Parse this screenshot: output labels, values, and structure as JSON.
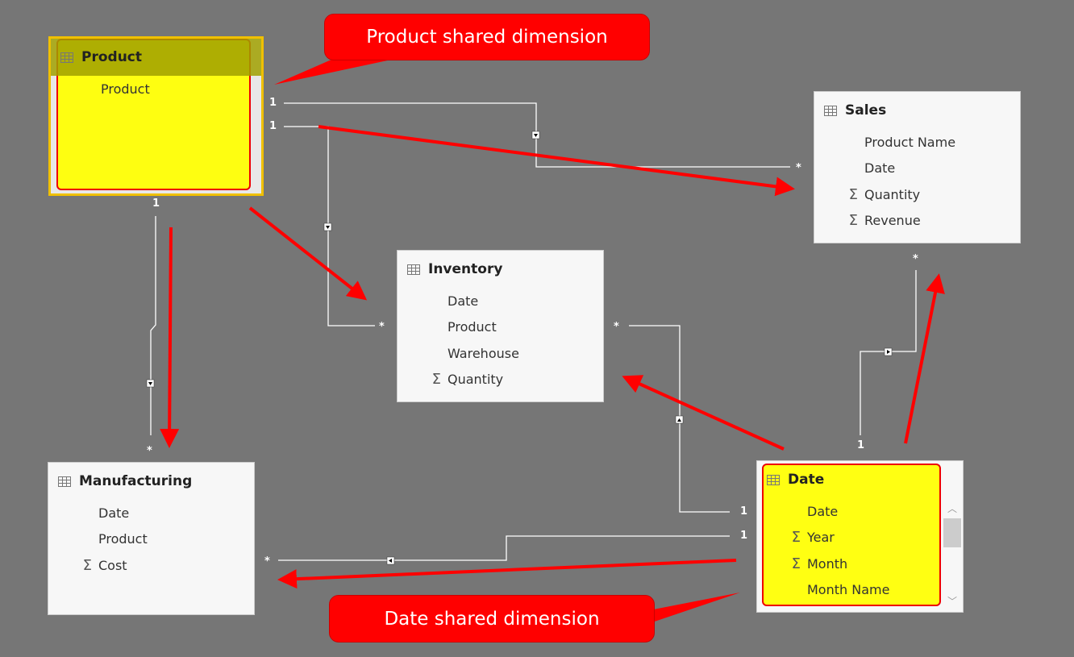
{
  "tables": {
    "product": {
      "title": "Product",
      "fields": [
        {
          "name": "Product",
          "sum": false
        }
      ]
    },
    "sales": {
      "title": "Sales",
      "fields": [
        {
          "name": "Product Name",
          "sum": false
        },
        {
          "name": "Date",
          "sum": false
        },
        {
          "name": "Quantity",
          "sum": true
        },
        {
          "name": "Revenue",
          "sum": true
        }
      ]
    },
    "inventory": {
      "title": "Inventory",
      "fields": [
        {
          "name": "Date",
          "sum": false
        },
        {
          "name": "Product",
          "sum": false
        },
        {
          "name": "Warehouse",
          "sum": false
        },
        {
          "name": "Quantity",
          "sum": true
        }
      ]
    },
    "manufacturing": {
      "title": "Manufacturing",
      "fields": [
        {
          "name": "Date",
          "sum": false
        },
        {
          "name": "Product",
          "sum": false
        },
        {
          "name": "Cost",
          "sum": true
        }
      ]
    },
    "date": {
      "title": "Date",
      "fields": [
        {
          "name": "Date",
          "sum": false
        },
        {
          "name": "Year",
          "sum": true
        },
        {
          "name": "Month",
          "sum": true
        },
        {
          "name": "Month Name",
          "sum": false
        }
      ]
    }
  },
  "sigma": "Σ",
  "callouts": {
    "product": "Product shared dimension",
    "date": "Date shared dimension"
  },
  "cardinality": {
    "one": "1",
    "many": "*"
  },
  "colors": {
    "background": "#767676",
    "highlight": "#ffff00",
    "annotation": "#ff0000"
  }
}
